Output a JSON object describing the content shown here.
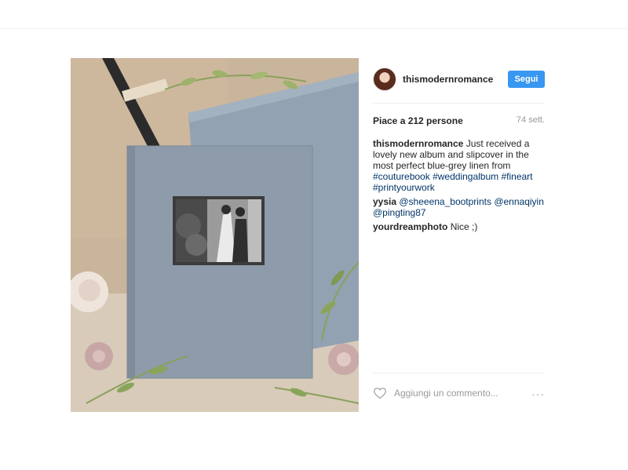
{
  "post": {
    "username": "thismodernromance",
    "follow_label": "Segui",
    "likes": "Piace a 212 persone",
    "age": "74 sett.",
    "caption": {
      "user": "thismodernromance",
      "text": "Just received a lovely new album and slipcover in the most perfect blue-grey linen from",
      "tags": [
        "#couturebook",
        "#weddingalbum",
        "#fineart",
        "#printyourwork"
      ]
    },
    "comments": [
      {
        "user": "yysia",
        "mentions": [
          "@sheeena_bootprints",
          "@ennaqiyin",
          "@pingting87"
        ]
      },
      {
        "user": "yourdreamphoto",
        "text": "Nice ;)"
      }
    ],
    "add_comment_placeholder": "Aggiungi un commento...",
    "more_icon": "···"
  },
  "icons": {
    "heart": "heart-icon",
    "more": "more-options-icon",
    "avatar": "avatar"
  },
  "colors": {
    "follow_button": "#3897f0",
    "hashtag": "#003569",
    "album_cover": "#8d9aa8"
  }
}
